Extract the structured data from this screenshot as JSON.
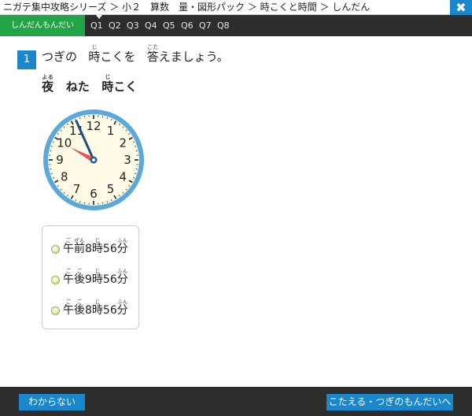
{
  "breadcrumb": "ニガテ集中攻略シリーズ ＞ 小２　算数　量・図形パック ＞ 時こくと時間 ＞ しんだん",
  "close_icon_glyph": "✖",
  "tabs": {
    "diagnostic": "しんだんもんだい",
    "questions": [
      "Q1",
      "Q2",
      "Q3",
      "Q4",
      "Q5",
      "Q6",
      "Q7",
      "Q8"
    ],
    "active": "Q1"
  },
  "question": {
    "number": "1",
    "part1": "つぎの",
    "word1": "時",
    "word1_ruby": "じ",
    "part2": "こくを",
    "word2": "答",
    "word2_ruby": "こた",
    "part3": "えましょう。"
  },
  "sub": {
    "word1": "夜",
    "word1_ruby": "よる",
    "part1": "ねた",
    "word2": "時",
    "word2_ruby": "じ",
    "part2": "こく"
  },
  "clock": {
    "numbers": [
      "12",
      "1",
      "2",
      "3",
      "4",
      "5",
      "6",
      "7",
      "8",
      "9",
      "10",
      "11"
    ],
    "hour_hand_value": 9,
    "minute_hand_value": 56,
    "colors": {
      "rim": "#5aa9dc",
      "face": "#fffbe6",
      "hour_hand": "#e8535b",
      "minute_hand": "#1e4d87",
      "center": "#1a5aa0"
    }
  },
  "choices": [
    {
      "parts": [
        {
          "text": "午",
          "ruby": "ご"
        },
        {
          "text": "前",
          "ruby": "ぜん"
        },
        {
          "text": "8",
          "ruby": ""
        },
        {
          "text": "時",
          "ruby": "じ"
        },
        {
          "text": "56",
          "ruby": ""
        },
        {
          "text": "分",
          "ruby": "ふん"
        }
      ]
    },
    {
      "parts": [
        {
          "text": "午",
          "ruby": "ご"
        },
        {
          "text": "後",
          "ruby": "ご"
        },
        {
          "text": "9",
          "ruby": ""
        },
        {
          "text": "時",
          "ruby": "じ"
        },
        {
          "text": "56",
          "ruby": ""
        },
        {
          "text": "分",
          "ruby": "ふん"
        }
      ]
    },
    {
      "parts": [
        {
          "text": "午",
          "ruby": "ご"
        },
        {
          "text": "後",
          "ruby": "ご"
        },
        {
          "text": "8",
          "ruby": ""
        },
        {
          "text": "時",
          "ruby": "じ"
        },
        {
          "text": "56",
          "ruby": ""
        },
        {
          "text": "分",
          "ruby": "ふん"
        }
      ]
    }
  ],
  "buttons": {
    "dont_know": "わからない",
    "answer_next": "こたえる・つぎのもんだいへ"
  }
}
